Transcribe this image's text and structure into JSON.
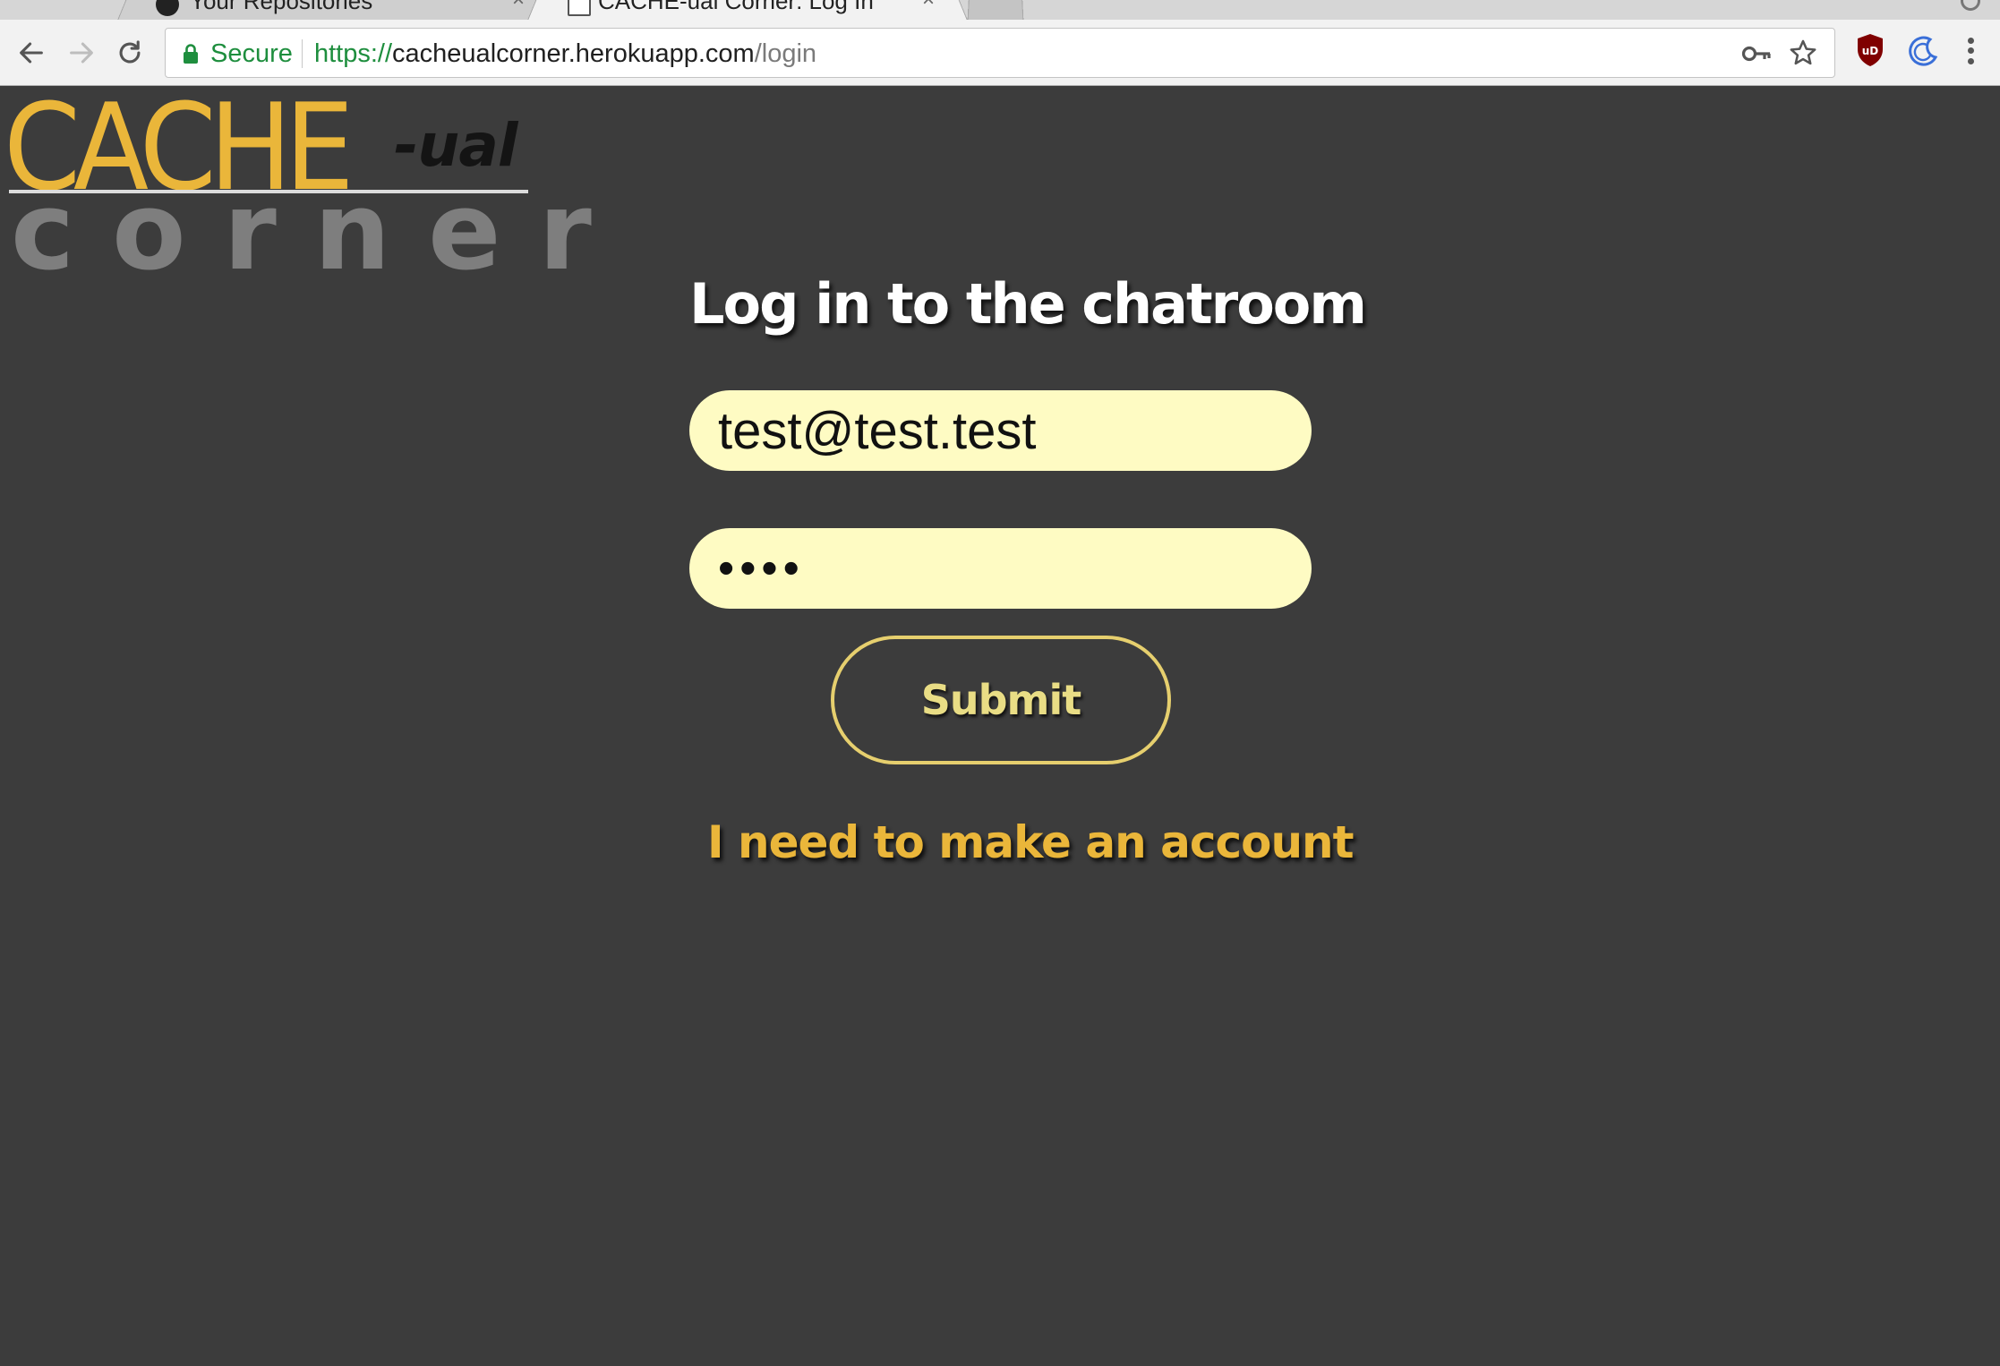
{
  "browser": {
    "tabs": [
      {
        "title": "Your Repositories",
        "close": "×"
      },
      {
        "title": "CACHE-ual Corner: Log In",
        "close": "×"
      }
    ],
    "omnibox": {
      "secure_label": "Secure",
      "url_scheme": "https://",
      "url_host": "cacheualcorner.herokuapp.com",
      "url_path": "/login"
    },
    "icons": [
      "back-icon",
      "forward-icon",
      "reload-icon",
      "lock-icon",
      "key-icon",
      "star-icon",
      "ublock-origin-icon",
      "moon-extension-icon",
      "menu-icon"
    ]
  },
  "logo": {
    "cache": "CACHE",
    "ual": "-ual",
    "corner": "corner",
    "colors": {
      "cache": "#eab63a",
      "ual": "#141414",
      "corner": "#7e7e7e"
    }
  },
  "login": {
    "title": "Log in to the chatroom",
    "email_value": "test@test.test",
    "password_value": "test",
    "submit_label": "Submit",
    "signup_link": "I need to make an account"
  },
  "colors": {
    "page_background": "#3c3c3c",
    "input_background": "#fefbc3",
    "accent": "#eab63a",
    "submit_border": "#e6cf6e"
  }
}
